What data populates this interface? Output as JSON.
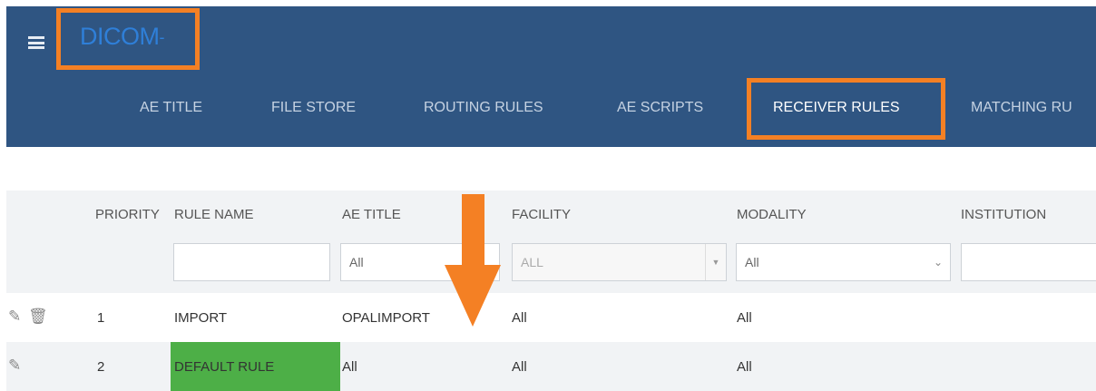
{
  "header": {
    "menu_icon": "hamburger-icon",
    "app_title": "DICOM",
    "title_arrow": "-",
    "tabs": [
      {
        "label": "AE TITLE",
        "active": false
      },
      {
        "label": "FILE STORE",
        "active": false
      },
      {
        "label": "ROUTING RULES",
        "active": false
      },
      {
        "label": "AE SCRIPTS",
        "active": false
      },
      {
        "label": "RECEIVER RULES",
        "active": true
      },
      {
        "label": "MATCHING RU",
        "active": false
      }
    ]
  },
  "table": {
    "columns": [
      "PRIORITY",
      "RULE NAME",
      "AE TITLE",
      "FACILITY",
      "MODALITY",
      "INSTITUTION"
    ],
    "filters": {
      "rule_name": "",
      "ae_title": "All",
      "facility": "ALL",
      "modality": "All",
      "institution": ""
    },
    "rows": [
      {
        "priority": "1",
        "rule_name": "IMPORT",
        "ae_title": "OPALIMPORT",
        "facility": "All",
        "modality": "All",
        "icons": [
          "pencil-icon",
          "trash-icon"
        ]
      },
      {
        "priority": "2",
        "rule_name": "DEFAULT RULE",
        "ae_title": "All",
        "facility": "All",
        "modality": "All",
        "icons": [
          "pencil-icon"
        ],
        "highlight_color": "#4daf47"
      }
    ]
  },
  "annotations": {
    "highlight_color": "#f48024"
  }
}
